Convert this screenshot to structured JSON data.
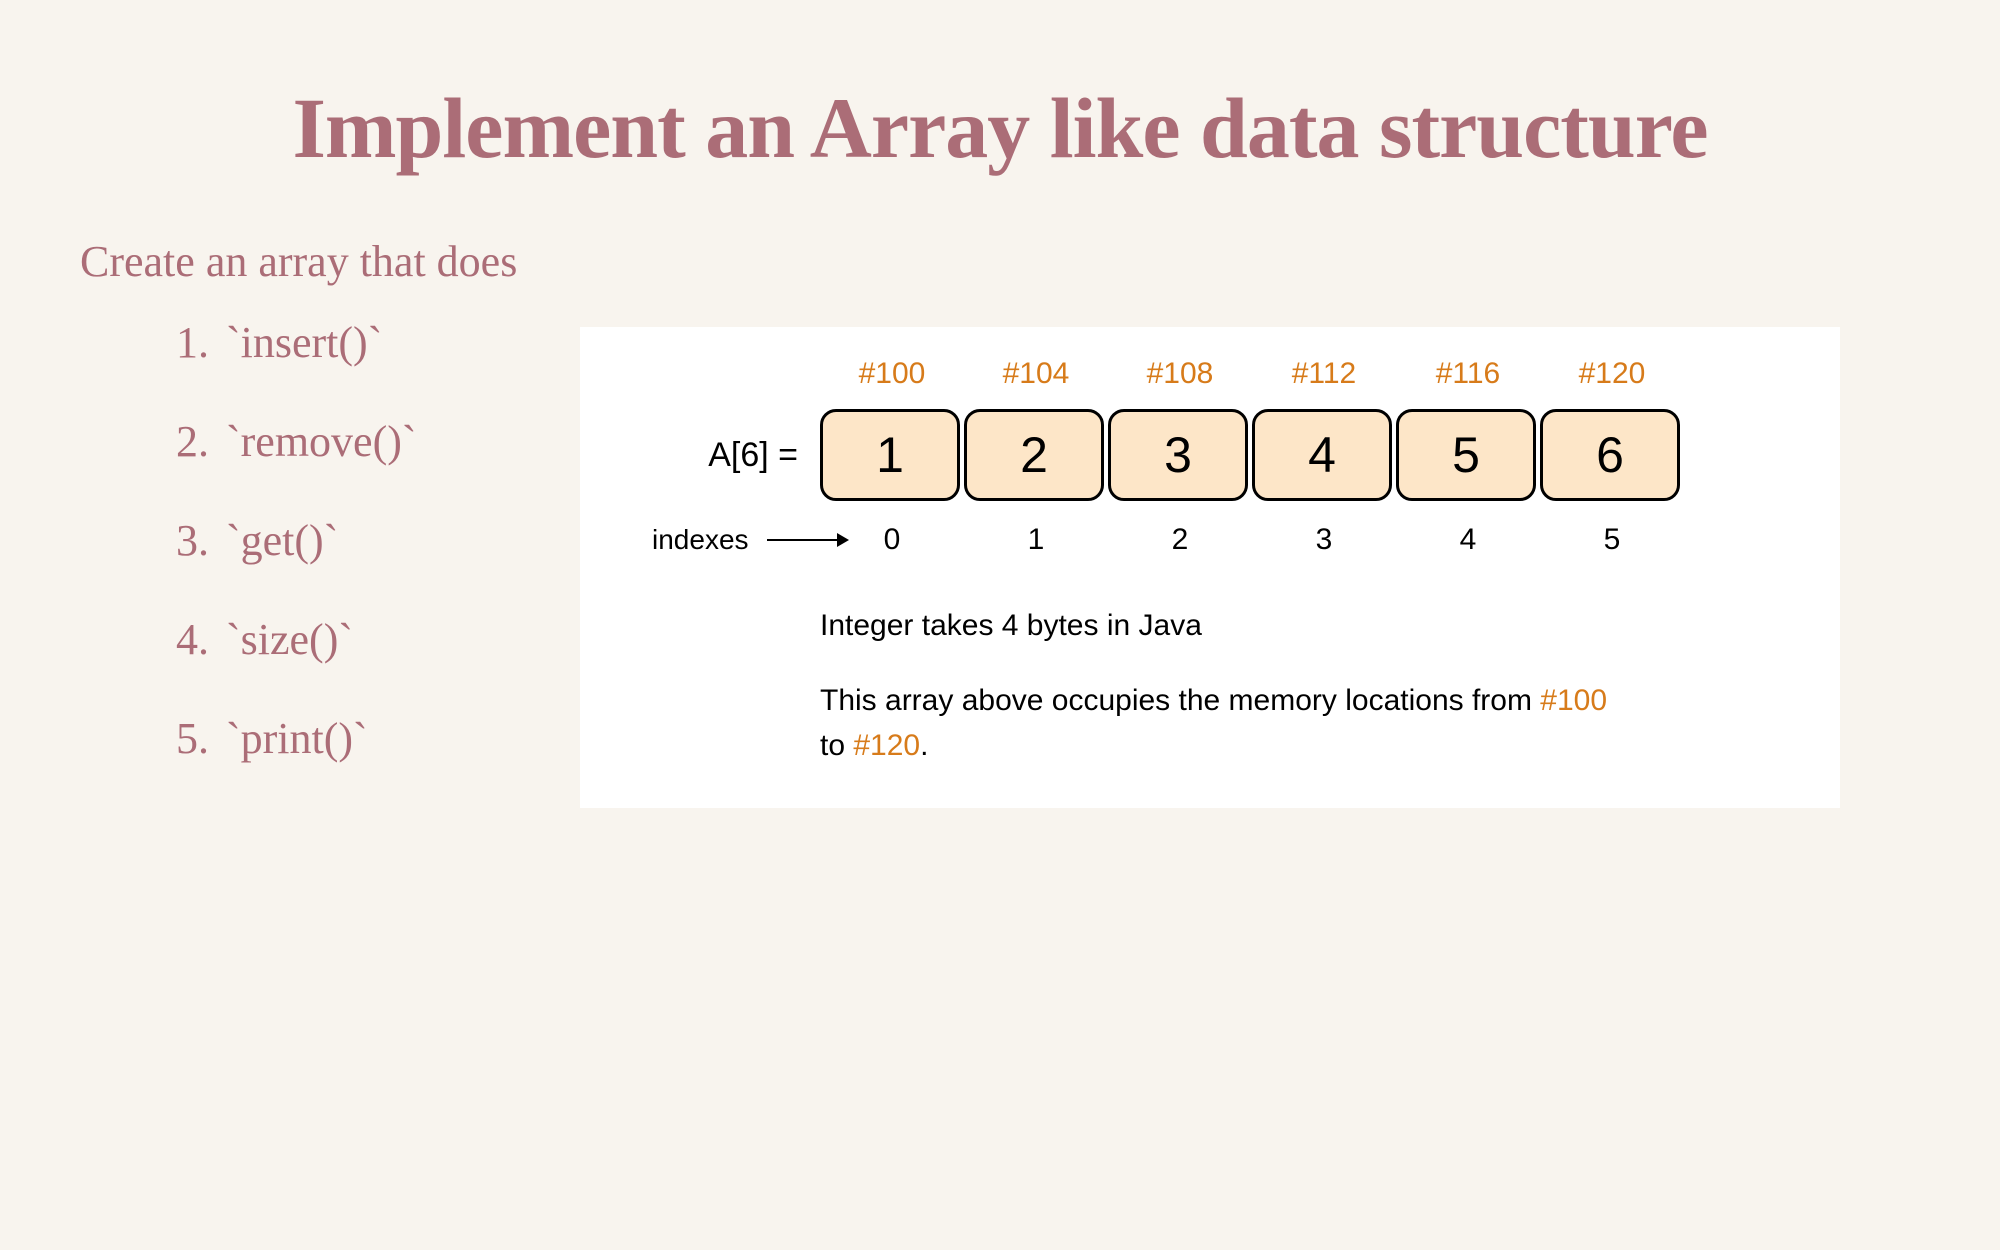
{
  "title": "Implement an Array like data structure",
  "subtitle": "Create an array that does",
  "ops": [
    "`insert()`",
    "`remove()`",
    "`get()`",
    "`size()`",
    "`print()`"
  ],
  "diagram": {
    "array_label": "A[6] =",
    "indexes_label": "indexes",
    "addresses": [
      "#100",
      "#104",
      "#108",
      "#112",
      "#116",
      "#120"
    ],
    "values": [
      "1",
      "2",
      "3",
      "4",
      "5",
      "6"
    ],
    "indexes": [
      "0",
      "1",
      "2",
      "3",
      "4",
      "5"
    ],
    "note1": "Integer takes 4 bytes in Java",
    "note2_pre": "This array above occupies the memory locations from ",
    "note2_from": "#100",
    "note2_mid": " to ",
    "note2_to": "#120",
    "note2_post": "."
  }
}
